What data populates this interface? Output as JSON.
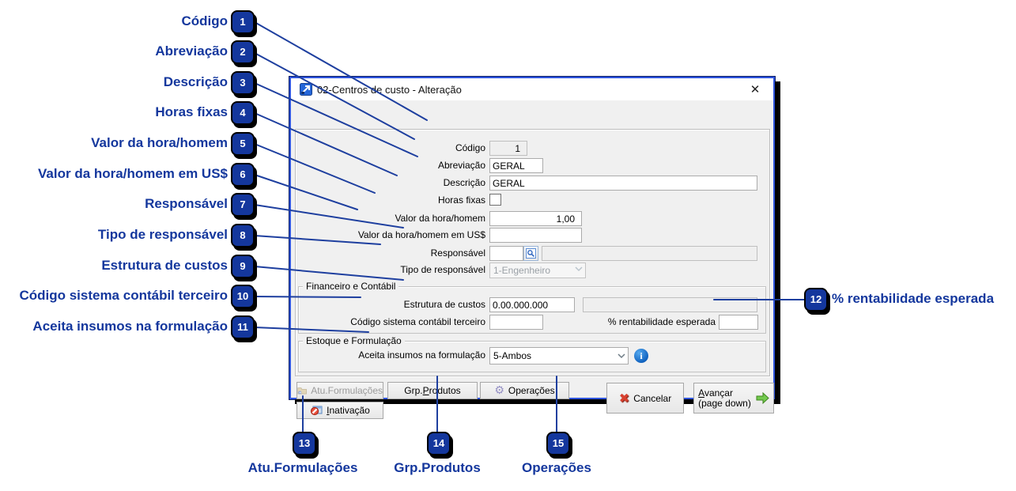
{
  "window": {
    "title": "02-Centros de custo - Alteração",
    "close_glyph": "✕"
  },
  "groups": {
    "financeiro": "Financeiro e Contábil",
    "estoque": "Estoque e Formulação"
  },
  "fields": {
    "codigo": {
      "label": "Código",
      "value": "1"
    },
    "abreviacao": {
      "label": "Abreviação",
      "value": "GERAL"
    },
    "descricao": {
      "label": "Descrição",
      "value": "GERAL"
    },
    "horas_fixas": {
      "label": "Horas fixas",
      "checked": false
    },
    "valor_hora": {
      "label": "Valor da hora/homem",
      "value": "1,00"
    },
    "valor_hora_usd": {
      "label": "Valor da hora/homem em US$",
      "value": ""
    },
    "responsavel": {
      "label": "Responsável",
      "code": "",
      "name": ""
    },
    "tipo_responsavel": {
      "label": "Tipo de responsável",
      "value": "1-Engenheiro"
    },
    "estrutura": {
      "label": "Estrutura de custos",
      "value": "0.00.000.000",
      "extra": ""
    },
    "cod_contabil": {
      "label": "Código sistema contábil terceiro",
      "value": ""
    },
    "rentabilidade": {
      "label": "% rentabilidade esperada",
      "value": ""
    },
    "aceita_insumos": {
      "label": "Aceita insumos na formulação",
      "value": "5-Ambos"
    }
  },
  "buttons": {
    "atu_formulacoes": {
      "label": "Atu.Formulações"
    },
    "grp_produtos": {
      "pre": "Grp.",
      "accel": "P",
      "post": "rodutos"
    },
    "operacoes": {
      "label": "Operações"
    },
    "inativacao": {
      "accel": "I",
      "post": "nativação"
    },
    "cancelar": {
      "label": "Cancelar"
    },
    "avancar": {
      "accel": "A",
      "post": "vançar",
      "line2": "(page down)"
    }
  },
  "callouts": [
    {
      "n": "1",
      "label": "Código"
    },
    {
      "n": "2",
      "label": "Abreviação"
    },
    {
      "n": "3",
      "label": "Descrição"
    },
    {
      "n": "4",
      "label": "Horas fixas"
    },
    {
      "n": "5",
      "label": "Valor da hora/homem"
    },
    {
      "n": "6",
      "label": "Valor da hora/homem em US$"
    },
    {
      "n": "7",
      "label": "Responsável"
    },
    {
      "n": "8",
      "label": "Tipo de responsável"
    },
    {
      "n": "9",
      "label": "Estrutura de custos"
    },
    {
      "n": "10",
      "label": "Código sistema contábil terceiro"
    },
    {
      "n": "11",
      "label": "Aceita insumos na formulação"
    },
    {
      "n": "12",
      "label": "% rentabilidade esperada"
    },
    {
      "n": "13",
      "label": "Atu.Formulações"
    },
    {
      "n": "14",
      "label": "Grp.Produtos"
    },
    {
      "n": "15",
      "label": "Operações"
    }
  ],
  "colors": {
    "annotation_blue": "#14379d",
    "line_blue": "#1e3f9f",
    "window_border_blue": "#2f55de",
    "dialog_bg": "#f0f0f0",
    "cancel_red": "#d8402f",
    "advance_green": "#72c94e"
  }
}
